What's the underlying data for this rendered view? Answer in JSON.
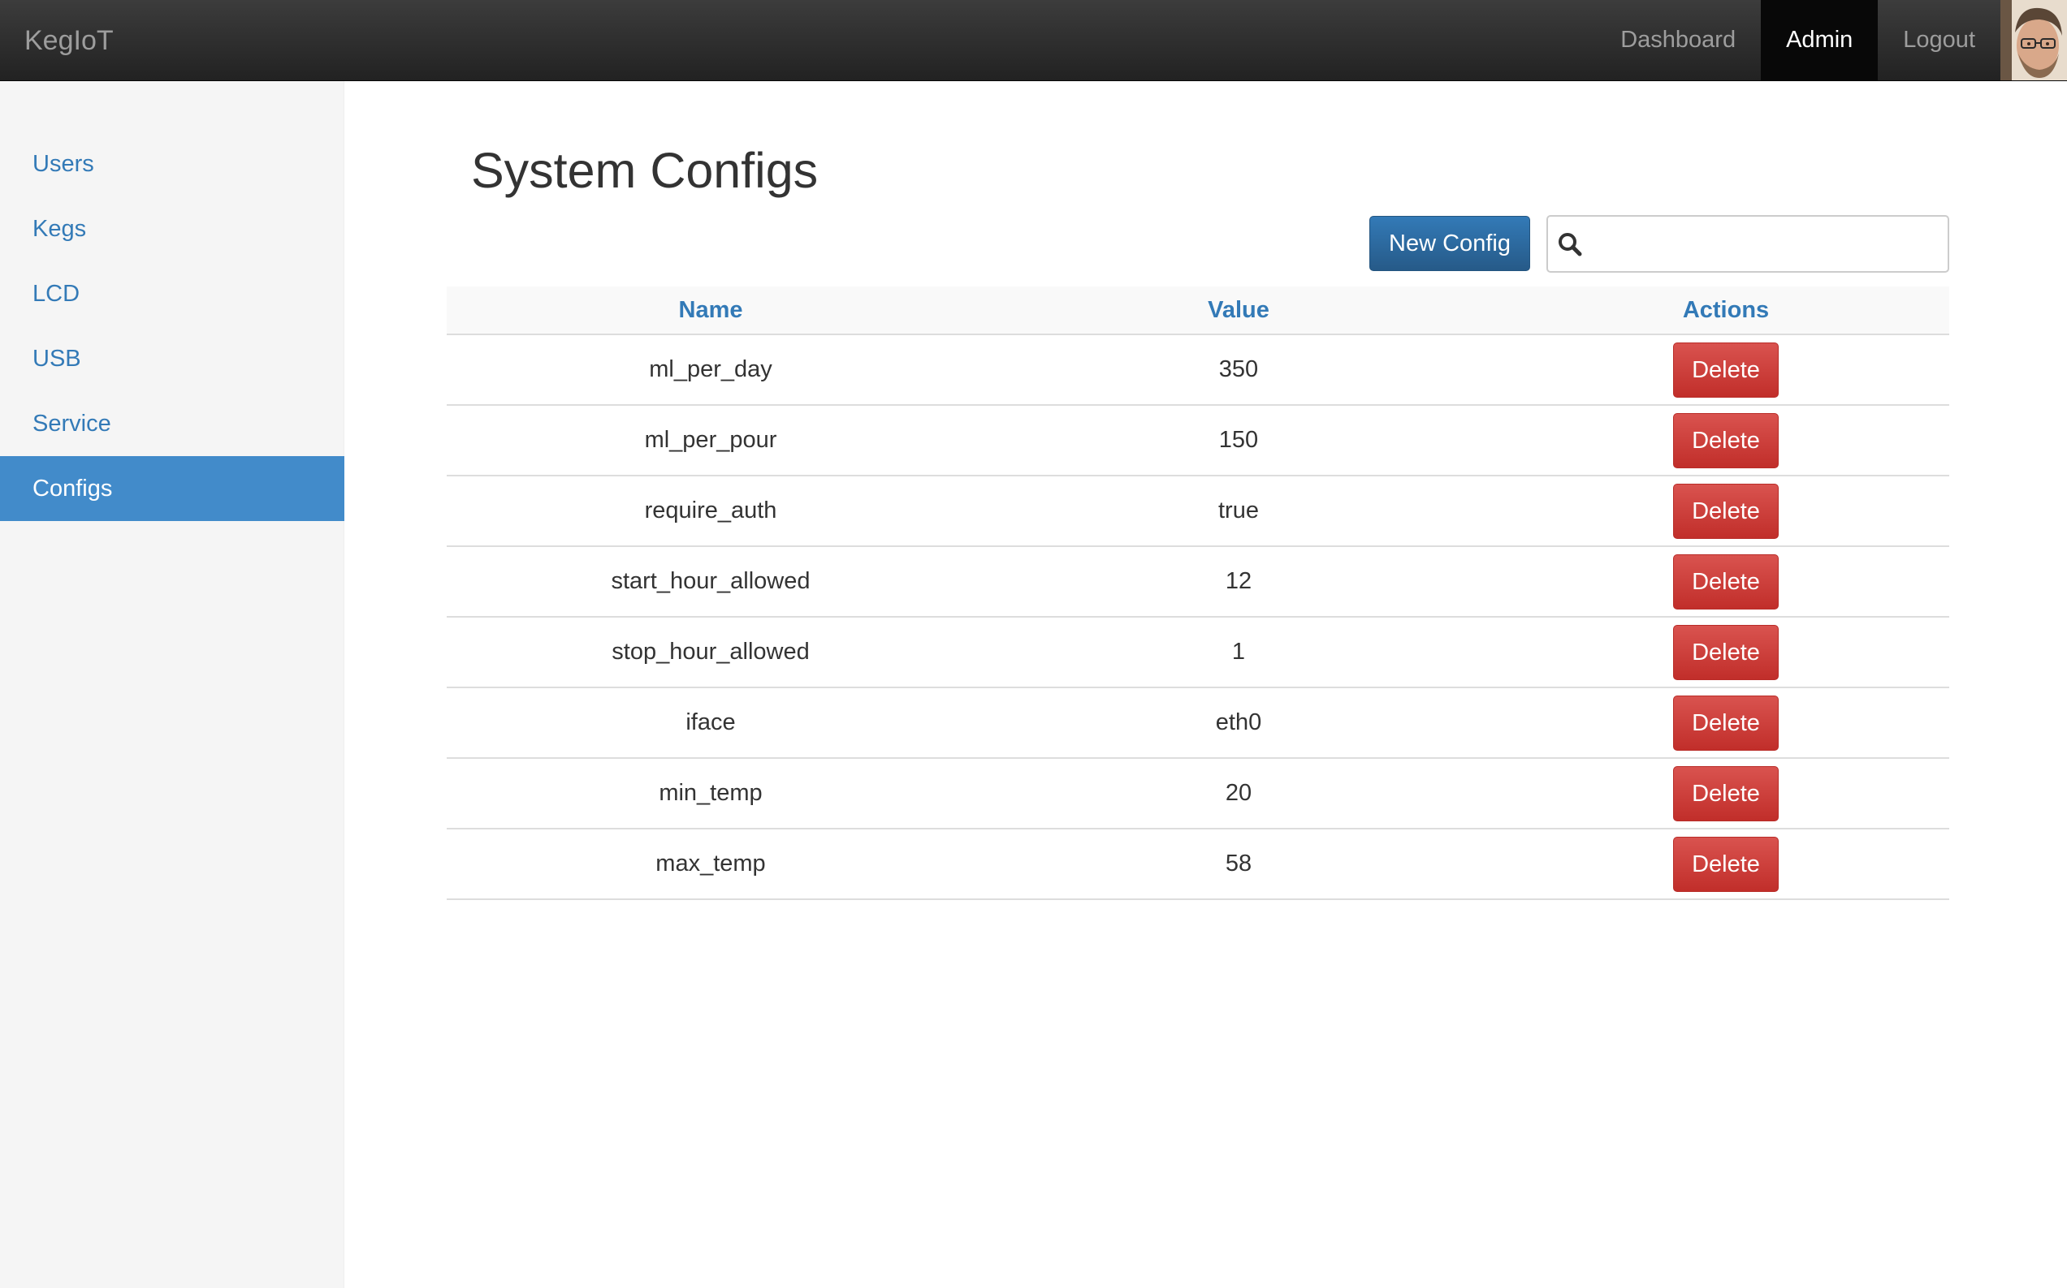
{
  "navbar": {
    "brand": "KegIoT",
    "links": [
      {
        "label": "Dashboard",
        "active": false
      },
      {
        "label": "Admin",
        "active": true
      },
      {
        "label": "Logout",
        "active": false
      }
    ],
    "colors": {
      "background": "#222222",
      "active_bg": "#080808",
      "text": "#9d9d9d"
    }
  },
  "sidebar": {
    "items": [
      {
        "label": "Users",
        "active": false
      },
      {
        "label": "Kegs",
        "active": false
      },
      {
        "label": "LCD",
        "active": false
      },
      {
        "label": "USB",
        "active": false
      },
      {
        "label": "Service",
        "active": false
      },
      {
        "label": "Configs",
        "active": true
      }
    ],
    "active_color": "#428bca"
  },
  "main": {
    "title": "System Configs",
    "new_button_label": "New Config",
    "search": {
      "value": "",
      "placeholder": "",
      "icon": "search-icon"
    }
  },
  "table": {
    "columns": [
      "Name",
      "Value",
      "Actions"
    ],
    "rows": [
      {
        "name": "ml_per_day",
        "value": "350",
        "action": "Delete"
      },
      {
        "name": "ml_per_pour",
        "value": "150",
        "action": "Delete"
      },
      {
        "name": "require_auth",
        "value": "true",
        "action": "Delete"
      },
      {
        "name": "start_hour_allowed",
        "value": "12",
        "action": "Delete"
      },
      {
        "name": "stop_hour_allowed",
        "value": "1",
        "action": "Delete"
      },
      {
        "name": "iface",
        "value": "eth0",
        "action": "Delete"
      },
      {
        "name": "min_temp",
        "value": "20",
        "action": "Delete"
      },
      {
        "name": "max_temp",
        "value": "58",
        "action": "Delete"
      }
    ],
    "colors": {
      "header_link": "#337ab7",
      "delete_button": "#d9534f"
    }
  }
}
